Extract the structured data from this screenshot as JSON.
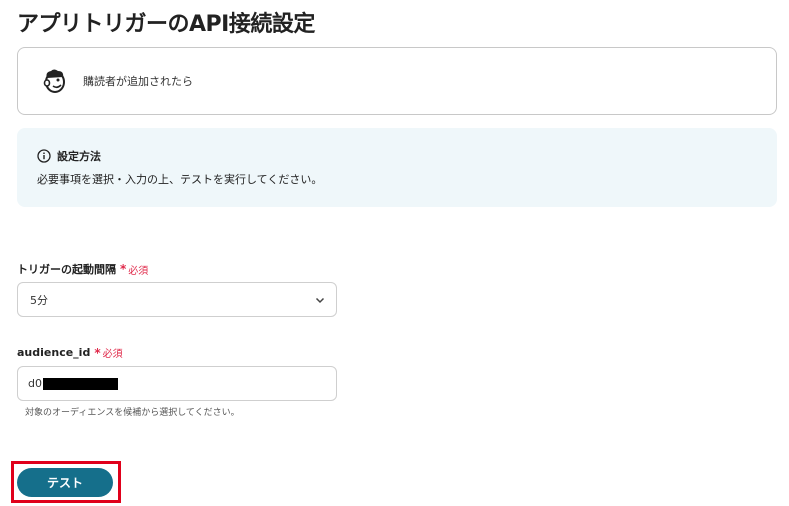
{
  "page": {
    "title": "アプリトリガーのAPI接続設定"
  },
  "trigger_app": {
    "icon": "mailchimp-logo-icon",
    "label": "購読者が追加されたら"
  },
  "info": {
    "icon": "info-circle-icon",
    "title": "設定方法",
    "text": "必要事項を選択・入力の上、テストを実行してください。"
  },
  "interval_field": {
    "label": "トリガーの起動間隔",
    "required_mark": "*",
    "required_text": "必須",
    "value": "5分"
  },
  "audience_field": {
    "label": "audience_id",
    "required_mark": "*",
    "required_text": "必須",
    "value_visible": "d0",
    "helper": "対象のオーディエンスを候補から選択してください。"
  },
  "actions": {
    "test_label": "テスト"
  },
  "colors": {
    "accent": "#156f8b",
    "required": "#e0294a",
    "highlight": "#e0001b",
    "info_bg": "#eff7fa"
  }
}
